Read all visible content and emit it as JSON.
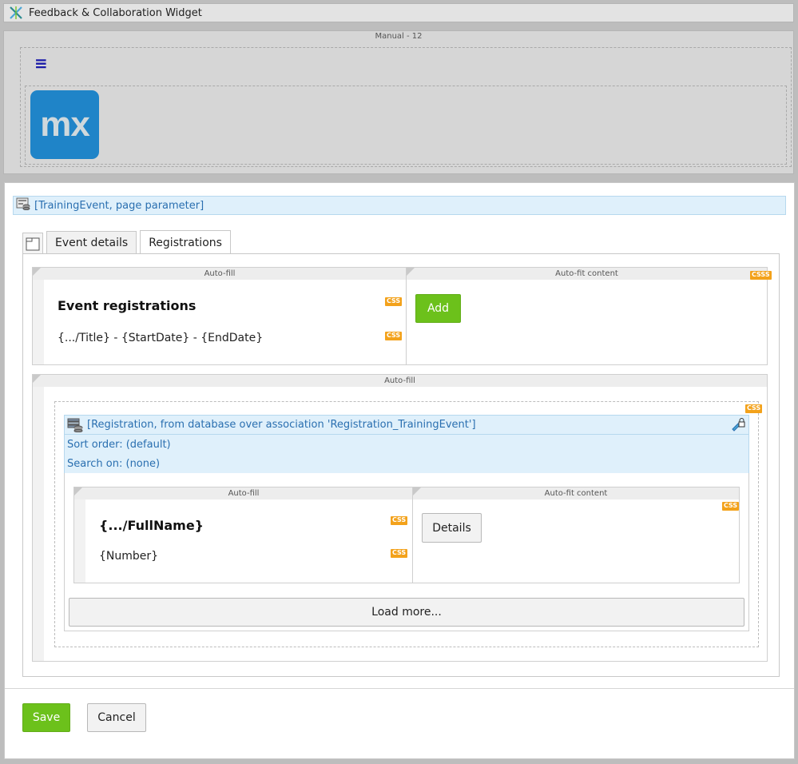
{
  "widget_bar": {
    "title": "Feedback & Collaboration Widget",
    "icon": "mendix-x-icon"
  },
  "layout_region": {
    "label": "Manual - 12",
    "menu_icon": "hamburger-menu-icon",
    "logo_text": "mx"
  },
  "dataview": {
    "header": "[TrainingEvent, page parameter]",
    "icon": "database-form-icon"
  },
  "tabs": [
    {
      "label": "Event details",
      "active": false
    },
    {
      "label": "Registrations",
      "active": true
    }
  ],
  "top_grid": {
    "col1_label": "Auto-fill",
    "col2_label": "Auto-fit content",
    "heading": "Event registrations",
    "subtitle": "{.../Title} - {StartDate} - {EndDate}",
    "add_button": "Add",
    "css_badge": "CSS",
    "css_badge_multi": "CSSS"
  },
  "bottom_grid": {
    "col_label": "Auto-fill"
  },
  "listview": {
    "header": "[Registration, from database over association 'Registration_TrainingEvent']",
    "sort_order": "Sort order: (default)",
    "search_on": "Search on: (none)",
    "inner_col1_label": "Auto-fill",
    "inner_col2_label": "Auto-fit content",
    "full_name": "{.../FullName}",
    "number": "{Number}",
    "details_button": "Details",
    "load_more": "Load more..."
  },
  "footer": {
    "save_label": "Save",
    "cancel_label": "Cancel"
  },
  "colors": {
    "accent_green": "#6cc11b",
    "info_blue": "#2a6fb0",
    "css_badge": "#f3a21b",
    "logo_blue": "#1f84c8"
  }
}
